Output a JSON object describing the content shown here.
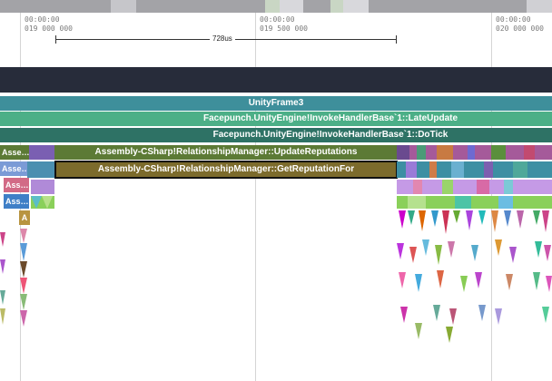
{
  "timeline": {
    "ticks": [
      {
        "time": "00:00:00",
        "frame": "019 000 000"
      },
      {
        "time": "00:00:00",
        "frame": "019 500 000"
      },
      {
        "time": "00:00:00",
        "frame": "020 000 000"
      }
    ],
    "measurement": "728us"
  },
  "flame": {
    "unity_frame": "UnityFrame3",
    "late_update": "Facepunch.UnityEngine!InvokeHandlerBase`1::LateUpdate",
    "do_tick": "Facepunch.UnityEngine!InvokeHandlerBase`1::DoTick",
    "update_reputations": "Assembly-CSharp!RelationshipManager::UpdateReputations",
    "get_reputation_for": "Assembly-CSharp!RelationshipManager::GetReputationFor",
    "left_labels": [
      "Asse…",
      "Asse…",
      "Ass…",
      "Ass…",
      "A"
    ]
  },
  "colors": {
    "unity_frame": "#3e8f9b",
    "late_update": "#4caf87",
    "do_tick": "#2e7265",
    "update_reputations": "#5c7a35",
    "get_reputation_for": "#7c6b2c",
    "thread_header": "#272c3a",
    "overview": "#a3a3a7"
  }
}
